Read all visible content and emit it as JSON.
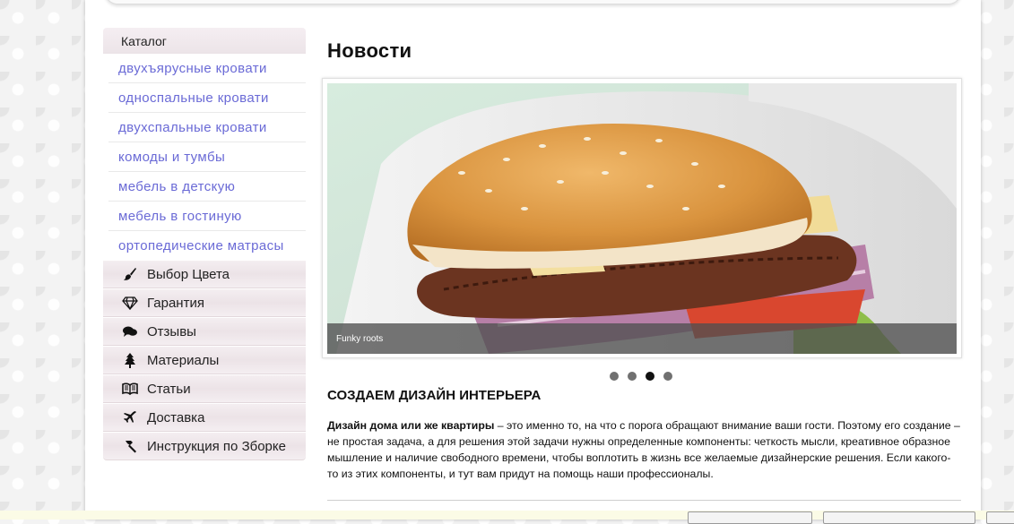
{
  "catalog": {
    "header": "Каталог",
    "items": [
      "двухъярусные кровати",
      "односпальные кровати",
      "двухспальные кровати",
      "комоды и тумбы",
      "мебель в детскую",
      "мебель в гостиную",
      "ортопедические матрасы"
    ]
  },
  "menu": [
    {
      "label": "Выбор Цвета",
      "icon": "brush-icon"
    },
    {
      "label": "Гарантия",
      "icon": "diamond-icon"
    },
    {
      "label": "Отзывы",
      "icon": "comments-icon"
    },
    {
      "label": "Материалы",
      "icon": "tree-icon"
    },
    {
      "label": "Статьи",
      "icon": "book-icon"
    },
    {
      "label": "Доставка",
      "icon": "airplane-icon"
    },
    {
      "label": "Инструкция по Зборке",
      "icon": "hammer-icon"
    }
  ],
  "news": {
    "title": "Новости",
    "slider": {
      "caption": "Funky roots",
      "dot_count": 4,
      "active_index": 2
    },
    "section_heading": "СОЗДАЕМ ДИЗАЙН ИНТЕРЬЕРА",
    "paragraph_bold": "Дизайн дома или же квартиры",
    "paragraph_rest": " – это именно то, на что с порога обращают внимание ваши гости. Поэтому его создание – не простая задача, а для решения этой задачи нужны определенные компоненты: четкость мысли, креативное образное мышление и наличие свободного времени, чтобы воплотить в жизнь все желаемые дизайнерские решения. Если какого-то из этих компоненты, и тут вам придут на помощь наши профессионалы."
  },
  "colors": {
    "link": "#6a6ad6",
    "menu_bg": "#ece3e7"
  }
}
